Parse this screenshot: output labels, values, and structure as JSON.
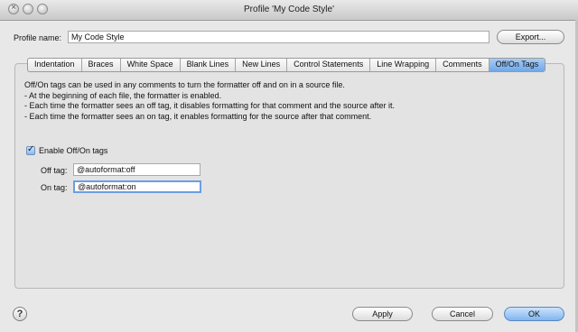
{
  "window": {
    "title": "Profile 'My Code Style'",
    "close_glyph": "×"
  },
  "profile": {
    "name_label": "Profile name:",
    "name_value": "My Code Style",
    "export_label": "Export..."
  },
  "tabs": [
    {
      "label": "Indentation"
    },
    {
      "label": "Braces"
    },
    {
      "label": "White Space"
    },
    {
      "label": "Blank Lines"
    },
    {
      "label": "New Lines"
    },
    {
      "label": "Control Statements"
    },
    {
      "label": "Line Wrapping"
    },
    {
      "label": "Comments"
    },
    {
      "label": "Off/On Tags",
      "selected": true
    }
  ],
  "description": [
    "Off/On tags can be used in any comments to turn the formatter off and on in a source file.",
    "- At the beginning of each file, the formatter is enabled.",
    "- Each time the formatter sees an off tag, it disables formatting for that comment and the source after it.",
    "- Each time the formatter sees an on tag, it enables formatting for the source after that comment."
  ],
  "enable": {
    "label": "Enable Off/On tags",
    "checked": true,
    "check_glyph": "✓"
  },
  "off_tag": {
    "label": "Off tag:",
    "value": "@autoformat:off"
  },
  "on_tag": {
    "label": "On tag:",
    "value": "@autoformat:on"
  },
  "footer": {
    "help_glyph": "?",
    "apply_label": "Apply",
    "cancel_label": "Cancel",
    "ok_label": "OK"
  },
  "colors": {
    "selected_tab": "#6fa8ea",
    "focus_ring": "#6b9ee3",
    "default_button": "#7fb5f0"
  }
}
